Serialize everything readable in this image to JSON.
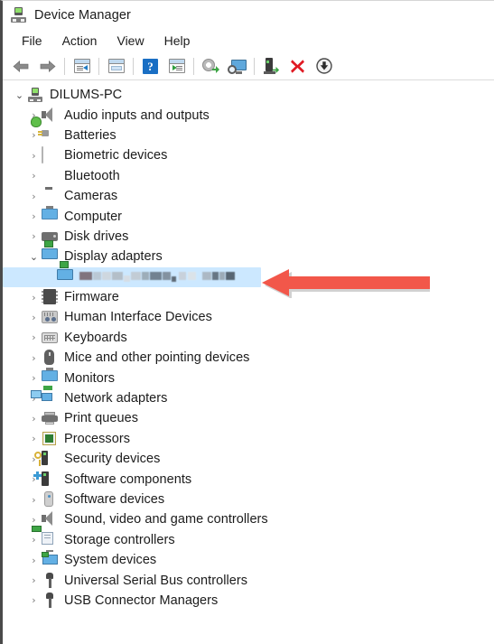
{
  "window": {
    "title": "Device Manager",
    "title_icon": "device-manager-icon"
  },
  "menu": {
    "items": [
      {
        "label": "File"
      },
      {
        "label": "Action"
      },
      {
        "label": "View"
      },
      {
        "label": "Help"
      }
    ]
  },
  "toolbar": {
    "buttons": [
      {
        "name": "back-icon",
        "tooltip": "Back"
      },
      {
        "name": "forward-icon",
        "tooltip": "Forward"
      },
      {
        "name": "show-hide-console-tree-icon",
        "tooltip": "Show/Hide Console Tree"
      },
      {
        "name": "properties-icon",
        "tooltip": "Properties"
      },
      {
        "name": "help-icon",
        "tooltip": "Help"
      },
      {
        "name": "show-hide-action-pane-icon",
        "tooltip": "Show/Hide Action Pane"
      },
      {
        "name": "update-driver-icon",
        "tooltip": "Update Driver Software"
      },
      {
        "name": "scan-for-hardware-changes-icon",
        "tooltip": "Scan for hardware changes"
      },
      {
        "name": "enable-device-icon",
        "tooltip": "Enable device"
      },
      {
        "name": "uninstall-device-icon",
        "tooltip": "Uninstall device"
      },
      {
        "name": "disable-device-icon",
        "tooltip": "Disable device"
      }
    ]
  },
  "tree": {
    "root": {
      "label": "DILUMS-PC",
      "expanded": true,
      "chevron": "⌄",
      "icon": "device-manager-icon"
    },
    "items": [
      {
        "label": "Audio inputs and outputs",
        "icon": "speaker-icon",
        "chevron": "›",
        "expanded": false
      },
      {
        "label": "Batteries",
        "icon": "battery-icon",
        "chevron": "›",
        "expanded": false
      },
      {
        "label": "Biometric devices",
        "icon": "fingerprint-icon",
        "chevron": "›",
        "expanded": false
      },
      {
        "label": "Bluetooth",
        "icon": "bluetooth-icon",
        "chevron": "›",
        "expanded": false
      },
      {
        "label": "Cameras",
        "icon": "camera-icon",
        "chevron": "›",
        "expanded": false
      },
      {
        "label": "Computer",
        "icon": "monitor-icon",
        "chevron": "›",
        "expanded": false
      },
      {
        "label": "Disk drives",
        "icon": "disk-drive-icon",
        "chevron": "›",
        "expanded": false
      },
      {
        "label": "Display adapters",
        "icon": "display-adapter-icon",
        "chevron": "⌄",
        "expanded": true
      },
      {
        "label": "Firmware",
        "icon": "firmware-chip-icon",
        "chevron": "›",
        "expanded": false
      },
      {
        "label": "Human Interface Devices",
        "icon": "hid-icon",
        "chevron": "›",
        "expanded": false
      },
      {
        "label": "Keyboards",
        "icon": "keyboard-icon",
        "chevron": "›",
        "expanded": false
      },
      {
        "label": "Mice and other pointing devices",
        "icon": "mouse-icon",
        "chevron": "›",
        "expanded": false
      },
      {
        "label": "Monitors",
        "icon": "monitor-icon",
        "chevron": "›",
        "expanded": false
      },
      {
        "label": "Network adapters",
        "icon": "network-adapter-icon",
        "chevron": "›",
        "expanded": false
      },
      {
        "label": "Print queues",
        "icon": "printer-icon",
        "chevron": "›",
        "expanded": false
      },
      {
        "label": "Processors",
        "icon": "processor-icon",
        "chevron": "›",
        "expanded": false
      },
      {
        "label": "Security devices",
        "icon": "security-device-icon",
        "chevron": "›",
        "expanded": false
      },
      {
        "label": "Software components",
        "icon": "software-component-icon",
        "chevron": "›",
        "expanded": false
      },
      {
        "label": "Software devices",
        "icon": "software-device-icon",
        "chevron": "›",
        "expanded": false
      },
      {
        "label": "Sound, video and game controllers",
        "icon": "speaker-icon",
        "chevron": "›",
        "expanded": false
      },
      {
        "label": "Storage controllers",
        "icon": "storage-controller-icon",
        "chevron": "›",
        "expanded": false
      },
      {
        "label": "System devices",
        "icon": "system-device-icon",
        "chevron": "›",
        "expanded": false
      },
      {
        "label": "Universal Serial Bus controllers",
        "icon": "usb-icon",
        "chevron": "›",
        "expanded": false
      },
      {
        "label": "USB Connector Managers",
        "icon": "usb-icon",
        "chevron": "›",
        "expanded": false
      }
    ],
    "selected_child": {
      "parent": "Display adapters",
      "label": "",
      "redacted": true,
      "icon": "display-adapter-icon",
      "selected": true
    }
  },
  "annotation": {
    "arrow": {
      "name": "red-pointer-arrow",
      "direction": "left",
      "color": "#F2574A",
      "points_at": "selected-display-adapter-row"
    }
  },
  "colors": {
    "selection_highlight": "#CCE8FF",
    "window_border": "#4A4A4A",
    "text": "#1B1B1B",
    "chevron": "#7A7A7A",
    "arrow_red": "#F2574A",
    "accent_blue": "#1A6FC4",
    "accent_green": "#3EA545"
  }
}
